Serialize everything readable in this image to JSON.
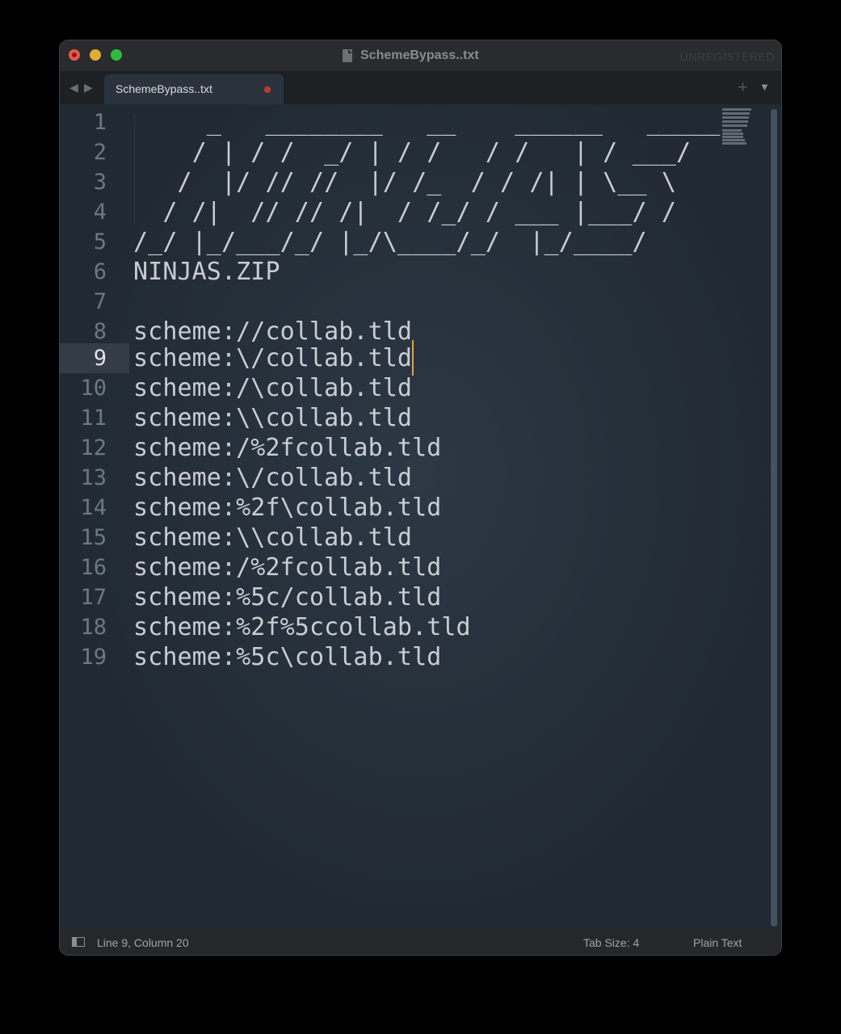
{
  "window": {
    "title": "SchemeBypass..txt",
    "registration_status": "UNREGISTERED"
  },
  "tabs": [
    {
      "label": "SchemeBypass..txt",
      "modified": true,
      "active": true
    }
  ],
  "editor": {
    "current_line": 9,
    "lines": [
      {
        "number": "1",
        "text": "     _   ________   __    ______   _____"
      },
      {
        "number": "2",
        "text": "    / | / /  _/ | / /   / /   | / ___/"
      },
      {
        "number": "3",
        "text": "   /  |/ // //  |/ /_  / / /| | \\__ \\"
      },
      {
        "number": "4",
        "text": "  / /|  // // /|  / /_/ / ___ |___/ /"
      },
      {
        "number": "5",
        "text": "/_/ |_/___/_/ |_/\\____/_/  |_/____/"
      },
      {
        "number": "6",
        "text": "NINJAS.ZIP"
      },
      {
        "number": "7",
        "text": ""
      },
      {
        "number": "8",
        "text": "scheme://collab.tld"
      },
      {
        "number": "9",
        "text": "scheme:\\/collab.tld"
      },
      {
        "number": "10",
        "text": "scheme:/\\collab.tld"
      },
      {
        "number": "11",
        "text": "scheme:\\\\collab.tld"
      },
      {
        "number": "12",
        "text": "scheme:/%2fcollab.tld"
      },
      {
        "number": "13",
        "text": "scheme:\\/collab.tld"
      },
      {
        "number": "14",
        "text": "scheme:%2f\\collab.tld"
      },
      {
        "number": "15",
        "text": "scheme:\\\\collab.tld"
      },
      {
        "number": "16",
        "text": "scheme:/%2fcollab.tld"
      },
      {
        "number": "17",
        "text": "scheme:%5c/collab.tld"
      },
      {
        "number": "18",
        "text": "scheme:%2f%5ccollab.tld"
      },
      {
        "number": "19",
        "text": "scheme:%5c\\collab.tld"
      }
    ]
  },
  "minimap": {
    "label": "NINJAS"
  },
  "status_bar": {
    "position": "Line 9, Column 20",
    "tab_size": "Tab Size: 4",
    "syntax": "Plain Text"
  },
  "colors": {
    "editor_bg": "#222b34",
    "text": "#c7cdd3",
    "line_number": "#6c7884",
    "cursor": "#e6a23c",
    "modified_dot": "#c0392b"
  },
  "icons": {
    "window_controls": [
      "close-icon",
      "minimize-icon",
      "maximize-icon"
    ],
    "file": "document-icon",
    "nav": [
      "chevron-left-icon",
      "chevron-right-icon"
    ],
    "new_tab": "plus-icon",
    "tab_menu": "triangle-down-icon",
    "sidebar_toggle": "sidebar-icon"
  }
}
